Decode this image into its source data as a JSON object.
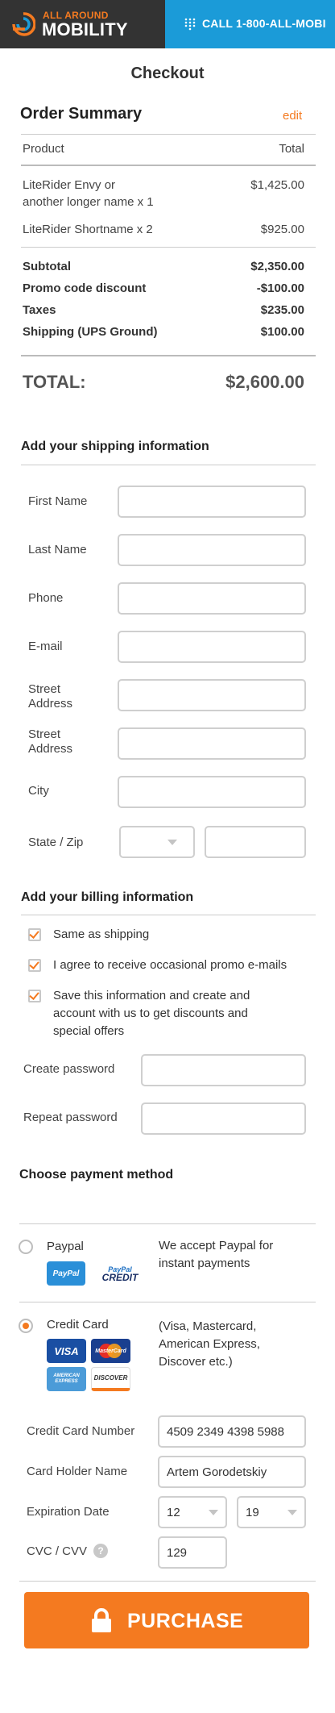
{
  "header": {
    "logo_small": "ALL AROUND",
    "logo_big": "MOBILITY",
    "call_text": "CALL 1-800-ALL-MOBI",
    "colors": {
      "dark": "#333333",
      "accent": "#f47a20",
      "blue": "#1b9bd8"
    }
  },
  "page_title": "Checkout",
  "order_summary": {
    "title": "Order Summary",
    "edit_label": "edit",
    "col_product": "Product",
    "col_total": "Total",
    "items": [
      {
        "name_line1": "LiteRider Envy or",
        "name_line2": "another longer name x 1",
        "price": "$1,425.00"
      },
      {
        "name_line1": "LiteRider Shortname x 2",
        "price": "$925.00"
      }
    ],
    "subtotal_label": "Subtotal",
    "subtotal_value": "$2,350.00",
    "promo_label": "Promo code discount",
    "promo_value": "-$100.00",
    "taxes_label": "Taxes",
    "taxes_value": "$235.00",
    "shipping_label": "Shipping (UPS Ground)",
    "shipping_value": "$100.00",
    "total_label": "TOTAL:",
    "total_value": "$2,600.00"
  },
  "shipping": {
    "title": "Add your shipping information",
    "first_name": "First Name",
    "last_name": "Last Name",
    "phone": "Phone",
    "email": "E-mail",
    "street1_a": "Street",
    "street1_b": "Address",
    "street2_a": "Street",
    "street2_b": "Address",
    "city": "City",
    "state_zip": "State / Zip"
  },
  "billing": {
    "title": "Add your billing information",
    "same_as_shipping": "Same as shipping",
    "promo_emails": "I agree to receive occasional promo e-mails",
    "save_line1": "Save this information and create and",
    "save_line2": "account with us to get discounts and",
    "save_line3": "special offers",
    "create_password": "Create password",
    "repeat_password": "Repeat password"
  },
  "payment": {
    "title": "Choose payment method",
    "paypal_label": "Paypal",
    "paypal_note_1": "We accept Paypal for",
    "paypal_note_2": "instant payments",
    "paypal_badge": "PayPal",
    "paypal_credit_top": "PayPal",
    "paypal_credit_bottom": "CREDIT",
    "credit_label": "Credit Card",
    "credit_note_1": "(Visa, Mastercard,",
    "credit_note_2": "American Express,",
    "credit_note_3": "Discover etc.)",
    "card_visa": "VISA",
    "card_mc": "MasterCard",
    "card_amex": "AMERICAN EXPRESS",
    "card_discover": "DISCOVER",
    "cc_number_label": "Credit Card Number",
    "cc_number_value": "4509 2349 4398 5988",
    "holder_label": "Card Holder Name",
    "holder_value": "Artem Gorodetskiy",
    "exp_label": "Expiration Date",
    "exp_month": "12",
    "exp_year": "19",
    "cvc_label": "CVC / CVV",
    "cvc_help": "?",
    "cvc_value": "129"
  },
  "purchase_label": "PURCHASE"
}
